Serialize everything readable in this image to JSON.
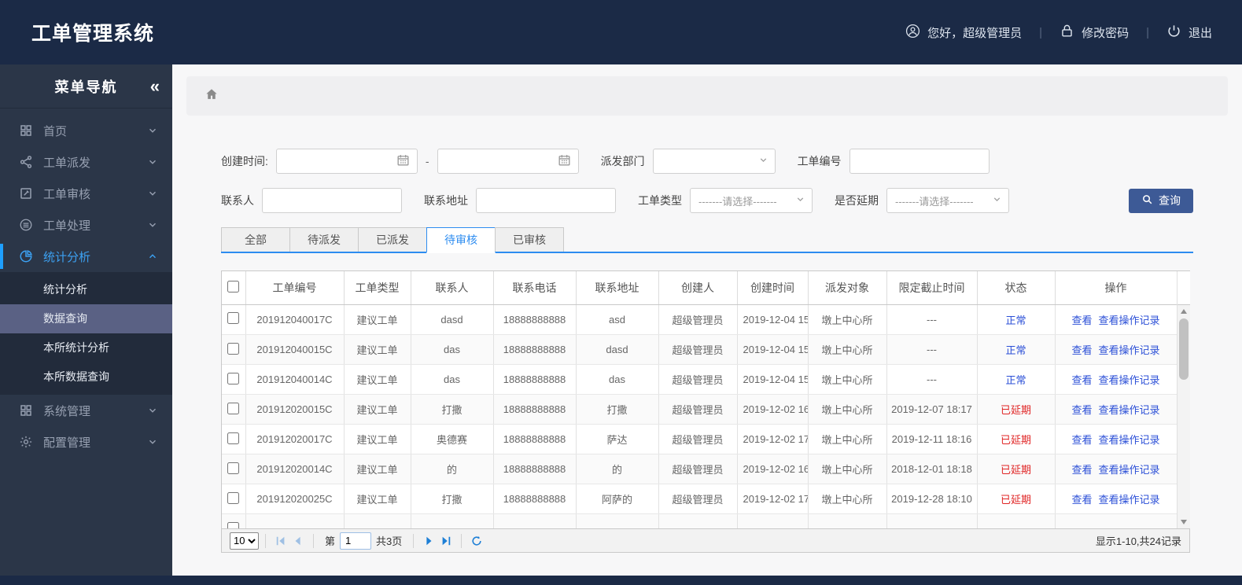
{
  "app": {
    "title": "工单管理系统"
  },
  "header": {
    "greeting": "您好，超级管理员",
    "greeting_icon": "user-circle-icon",
    "change_password": "修改密码",
    "change_password_icon": "lock-icon",
    "logout": "退出",
    "logout_icon": "power-icon"
  },
  "sidebar": {
    "title": "菜单导航",
    "collapse_icon": "double-chevron-left-icon",
    "items": [
      {
        "label": "首页",
        "icon": "grid-icon"
      },
      {
        "label": "工单派发",
        "icon": "share-icon"
      },
      {
        "label": "工单审核",
        "icon": "edit-icon"
      },
      {
        "label": "工单处理",
        "icon": "stack-icon"
      },
      {
        "label": "统计分析",
        "icon": "pie-chart-icon",
        "expanded": true,
        "children": [
          "统计分析",
          "数据查询",
          "本所统计分析",
          "本所数据查询"
        ],
        "active_child_index": 1
      },
      {
        "label": "系统管理",
        "icon": "modules-icon"
      },
      {
        "label": "配置管理",
        "icon": "gear-icon"
      }
    ]
  },
  "breadcrumb": {
    "home_icon": "home-icon"
  },
  "filters": {
    "create_time_label": "创建时间:",
    "date_from_value": "",
    "date_to_value": "",
    "range_separator": "-",
    "dept_label": "派发部门",
    "dept_value": "",
    "order_no_label": "工单编号",
    "order_no_value": "",
    "contact_label": "联系人",
    "contact_value": "",
    "address_label": "联系地址",
    "address_value": "",
    "type_label": "工单类型",
    "type_value": "-------请选择-------",
    "delay_label": "是否延期",
    "delay_value": "-------请选择-------",
    "search_button": "查询",
    "search_icon": "search-icon"
  },
  "tabs": [
    {
      "label": "全部",
      "active": false
    },
    {
      "label": "待派发",
      "active": false
    },
    {
      "label": "已派发",
      "active": false
    },
    {
      "label": "待审核",
      "active": true
    },
    {
      "label": "已审核",
      "active": false
    }
  ],
  "table": {
    "columns": [
      "工单编号",
      "工单类型",
      "联系人",
      "联系电话",
      "联系地址",
      "创建人",
      "创建时间",
      "派发对象",
      "限定截止时间",
      "状态",
      "操作"
    ],
    "action_view": "查看",
    "action_log": "查看操作记录",
    "rows": [
      {
        "order_no": "201912040017C",
        "type": "建议工单",
        "contact": "dasd",
        "phone": "18888888888",
        "address": "asd",
        "creator": "超级管理员",
        "created": "2019-12-04 15",
        "target": "墩上中心所",
        "deadline": "---",
        "status": "正常",
        "status_state": "normal"
      },
      {
        "order_no": "201912040015C",
        "type": "建议工单",
        "contact": "das",
        "phone": "18888888888",
        "address": "dasd",
        "creator": "超级管理员",
        "created": "2019-12-04 15",
        "target": "墩上中心所",
        "deadline": "---",
        "status": "正常",
        "status_state": "normal"
      },
      {
        "order_no": "201912040014C",
        "type": "建议工单",
        "contact": "das",
        "phone": "18888888888",
        "address": "das",
        "creator": "超级管理员",
        "created": "2019-12-04 15",
        "target": "墩上中心所",
        "deadline": "---",
        "status": "正常",
        "status_state": "normal"
      },
      {
        "order_no": "201912020015C",
        "type": "建议工单",
        "contact": "打撒",
        "phone": "18888888888",
        "address": "打撒",
        "creator": "超级管理员",
        "created": "2019-12-02 16",
        "target": "墩上中心所",
        "deadline": "2019-12-07 18:17",
        "status": "已延期",
        "status_state": "overdue"
      },
      {
        "order_no": "201912020017C",
        "type": "建议工单",
        "contact": "奥德赛",
        "phone": "18888888888",
        "address": "萨达",
        "creator": "超级管理员",
        "created": "2019-12-02 17",
        "target": "墩上中心所",
        "deadline": "2019-12-11 18:16",
        "status": "已延期",
        "status_state": "overdue"
      },
      {
        "order_no": "201912020014C",
        "type": "建议工单",
        "contact": "的",
        "phone": "18888888888",
        "address": "的",
        "creator": "超级管理员",
        "created": "2019-12-02 16",
        "target": "墩上中心所",
        "deadline": "2018-12-01 18:18",
        "status": "已延期",
        "status_state": "overdue"
      },
      {
        "order_no": "201912020025C",
        "type": "建议工单",
        "contact": "打撒",
        "phone": "18888888888",
        "address": "阿萨的",
        "creator": "超级管理员",
        "created": "2019-12-02 17",
        "target": "墩上中心所",
        "deadline": "2019-12-28 18:10",
        "status": "已延期",
        "status_state": "overdue"
      }
    ]
  },
  "pagination": {
    "page_size": "10",
    "page_prefix": "第",
    "current_page": "1",
    "total_pages_label": "共3页",
    "record_summary": "显示1-10,共24记录"
  }
}
